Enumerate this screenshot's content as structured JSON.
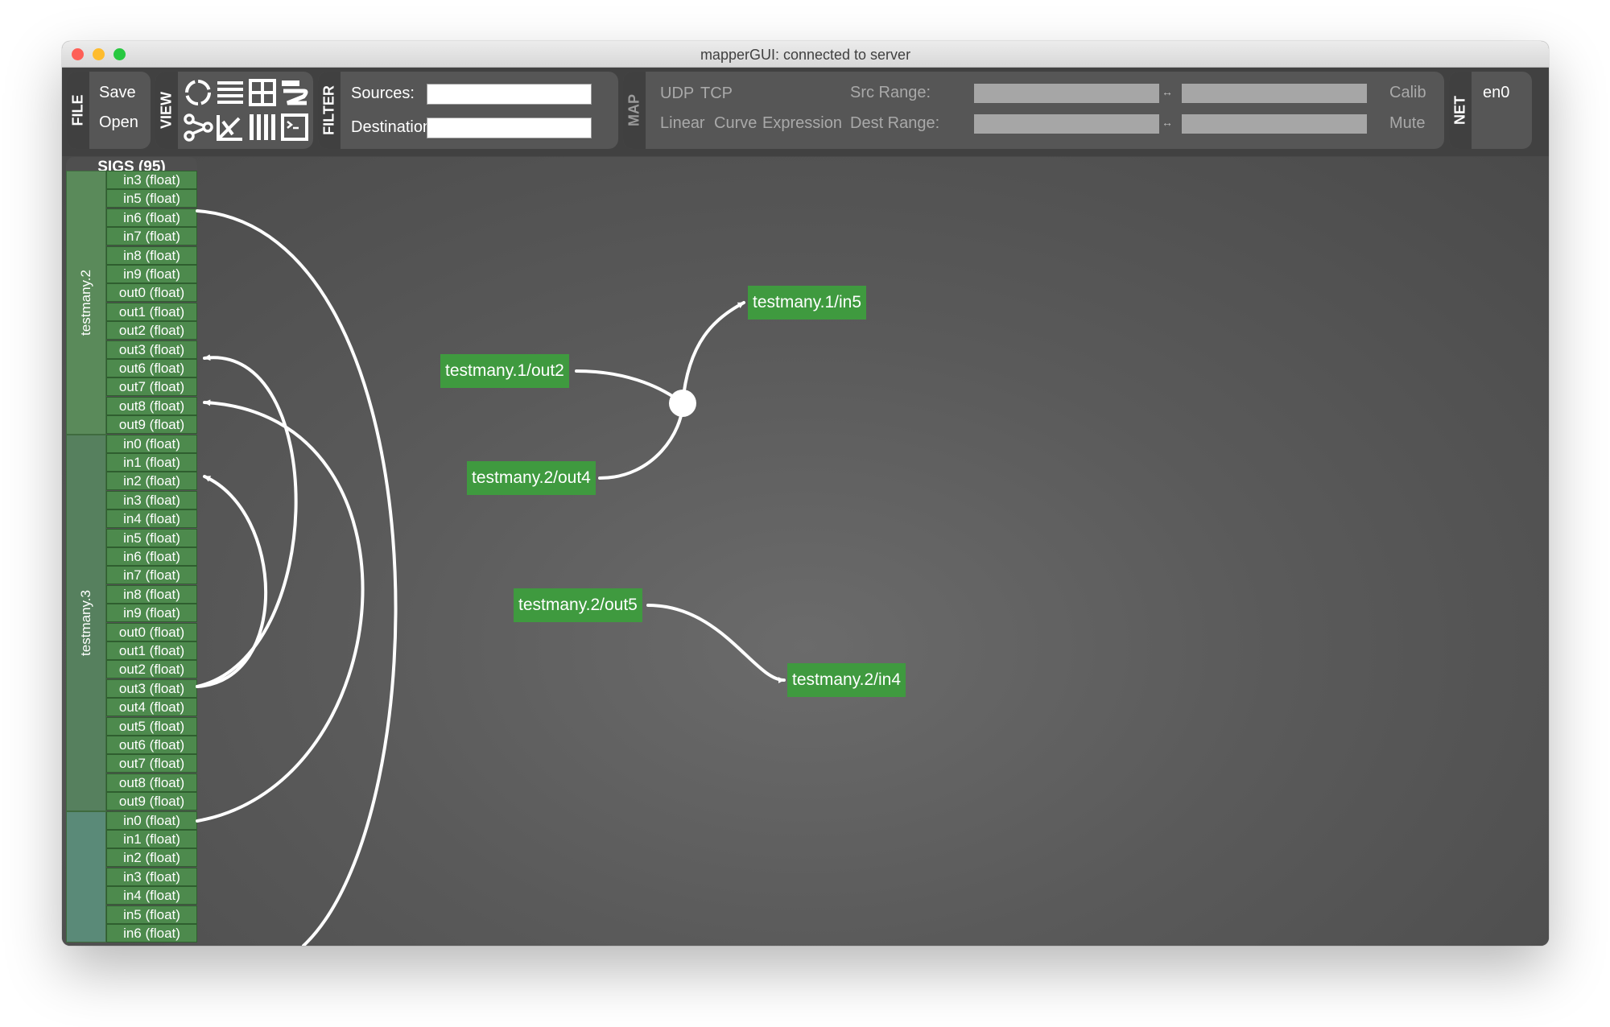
{
  "window": {
    "title": "mapperGUI: connected to server"
  },
  "toolbar": {
    "file": {
      "tab": "FILE",
      "save": "Save",
      "open": "Open"
    },
    "view": {
      "tab": "VIEW",
      "icons": [
        "chord-icon",
        "list-icon",
        "grid-icon",
        "hive-icon",
        "graph-icon",
        "balloon-icon",
        "parallel-icon",
        "console-icon"
      ]
    },
    "filter": {
      "tab": "FILTER",
      "sources_label": "Sources:",
      "destinations_label": "Destinations:",
      "sources_value": "",
      "destinations_value": ""
    },
    "map": {
      "tab": "MAP",
      "udp": "UDP",
      "tcp": "TCP",
      "linear": "Linear",
      "curve": "Curve",
      "expression": "Expression",
      "src_range": "Src Range:",
      "dest_range": "Dest Range:",
      "calib": "Calib",
      "mute": "Mute"
    },
    "net": {
      "tab": "NET",
      "interface": "en0"
    }
  },
  "sigs": {
    "header": "SIGS (95)",
    "devices": [
      {
        "name": "testmany.2",
        "signals": [
          "in3 (float)",
          "in5 (float)",
          "in6 (float)",
          "in7 (float)",
          "in8 (float)",
          "in9 (float)",
          "out0 (float)",
          "out1 (float)",
          "out2 (float)",
          "out3 (float)",
          "out6 (float)",
          "out7 (float)",
          "out8 (float)",
          "out9 (float)"
        ]
      },
      {
        "name": "testmany.3",
        "signals": [
          "in0 (float)",
          "in1 (float)",
          "in2 (float)",
          "in3 (float)",
          "in4 (float)",
          "in5 (float)",
          "in6 (float)",
          "in7 (float)",
          "in8 (float)",
          "in9 (float)",
          "out0 (float)",
          "out1 (float)",
          "out2 (float)",
          "out3 (float)",
          "out4 (float)",
          "out5 (float)",
          "out6 (float)",
          "out7 (float)",
          "out8 (float)",
          "out9 (float)"
        ]
      },
      {
        "name": "",
        "signals": [
          "in0 (float)",
          "in1 (float)",
          "in2 (float)",
          "in3 (float)",
          "in4 (float)",
          "in5 (float)",
          "in6 (float)"
        ]
      }
    ]
  },
  "canvas": {
    "nodes": {
      "n1": "testmany.1/in5",
      "n2": "testmany.1/out2",
      "n3": "testmany.2/out4",
      "n4": "testmany.2/out5",
      "n5": "testmany.2/in4"
    }
  },
  "colors": {
    "signal": "#4d8a4d",
    "node": "#3f9a3f",
    "device1": "#5a8a5a",
    "device2": "#56805e",
    "device3": "#5a8a78"
  }
}
